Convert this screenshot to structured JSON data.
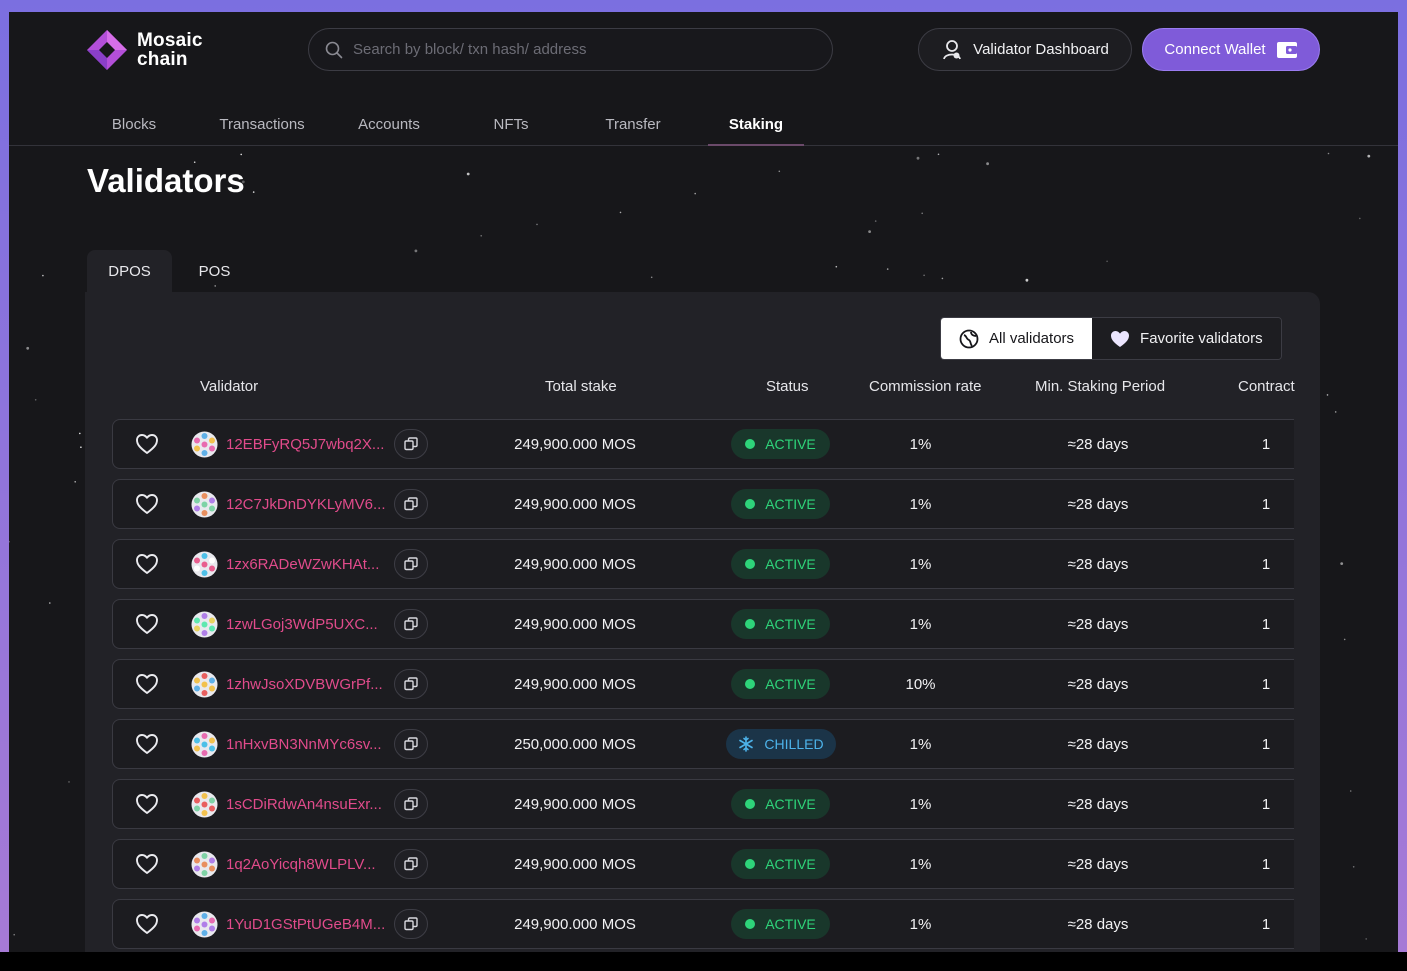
{
  "brand": {
    "line1": "Mosaic",
    "line2": "chain"
  },
  "search": {
    "placeholder": "Search by block/ txn hash/ address"
  },
  "header": {
    "validator_dashboard": "Validator Dashboard",
    "connect_wallet": "Connect Wallet"
  },
  "nav": {
    "items": [
      {
        "label": "Blocks"
      },
      {
        "label": "Transactions"
      },
      {
        "label": "Accounts"
      },
      {
        "label": "NFTs"
      },
      {
        "label": "Transfer"
      },
      {
        "label": "Staking"
      }
    ],
    "active": "Staking"
  },
  "page": {
    "title": "Validators"
  },
  "tabs": {
    "dpos": "DPOS",
    "pos": "POS"
  },
  "filter": {
    "all": "All validators",
    "favorite": "Favorite validators"
  },
  "table": {
    "columns": {
      "validator": "Validator",
      "total_stake": "Total stake",
      "status": "Status",
      "commission": "Commission rate",
      "period": "Min. Staking Period",
      "contract": "Contract"
    },
    "rows": [
      {
        "address": "12EBFyRQ5J7wbq2X...",
        "stake": "249,900.000 MOS",
        "status": "ACTIVE",
        "commission": "1%",
        "period": "≈28 days",
        "contract": "1"
      },
      {
        "address": "12C7JkDnDYKLyMV6...",
        "stake": "249,900.000 MOS",
        "status": "ACTIVE",
        "commission": "1%",
        "period": "≈28 days",
        "contract": "1"
      },
      {
        "address": "1zx6RADeWZwKHAt...",
        "stake": "249,900.000 MOS",
        "status": "ACTIVE",
        "commission": "1%",
        "period": "≈28 days",
        "contract": "1"
      },
      {
        "address": "1zwLGoj3WdP5UXC...",
        "stake": "249,900.000 MOS",
        "status": "ACTIVE",
        "commission": "1%",
        "period": "≈28 days",
        "contract": "1"
      },
      {
        "address": "1zhwJsoXDVBWGrPf...",
        "stake": "249,900.000 MOS",
        "status": "ACTIVE",
        "commission": "10%",
        "period": "≈28 days",
        "contract": "1"
      },
      {
        "address": "1nHxvBN3NnMYc6sv...",
        "stake": "250,000.000 MOS",
        "status": "CHILLED",
        "commission": "1%",
        "period": "≈28 days",
        "contract": "1"
      },
      {
        "address": "1sCDiRdwAn4nsuExr...",
        "stake": "249,900.000 MOS",
        "status": "ACTIVE",
        "commission": "1%",
        "period": "≈28 days",
        "contract": "1"
      },
      {
        "address": "1q2AoYicqh8WLPLV...",
        "stake": "249,900.000 MOS",
        "status": "ACTIVE",
        "commission": "1%",
        "period": "≈28 days",
        "contract": "1"
      },
      {
        "address": "1YuD1GStPtUGeB4M...",
        "stake": "249,900.000 MOS",
        "status": "ACTIVE",
        "commission": "1%",
        "period": "≈28 days",
        "contract": "1"
      }
    ]
  },
  "colors": {
    "accent": "#7f5bd9",
    "address": "#e14b8b",
    "active": "#2ed47a",
    "chilled": "#4db3ea",
    "background": "#17171a"
  }
}
